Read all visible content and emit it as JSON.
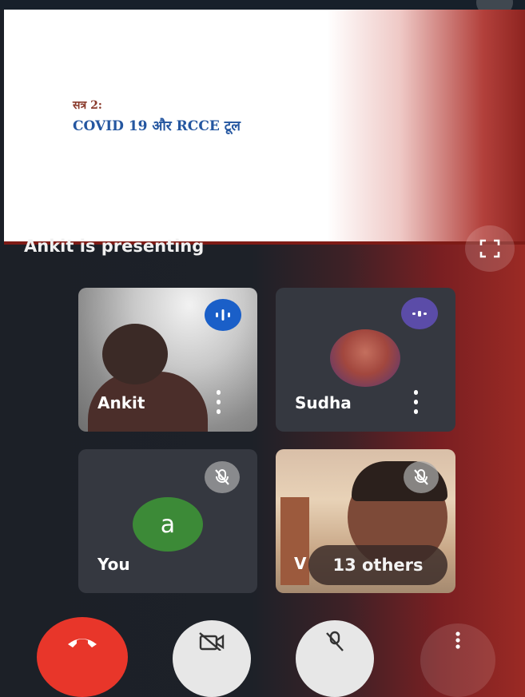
{
  "presentation": {
    "slide_line1": "सत्र 2:",
    "slide_line2": "COVID 19 और RCCE टूल",
    "presenter_status": "Ankit is presenting"
  },
  "participants": [
    {
      "name": "Ankit",
      "state": "speaking"
    },
    {
      "name": "Sudha",
      "state": "speaking"
    },
    {
      "name": "You",
      "avatar_letter": "a",
      "state": "muted"
    },
    {
      "name": "V",
      "state": "muted"
    }
  ],
  "others_count_label": "13 others",
  "colors": {
    "speaking_badge": "#1a5fc8",
    "speaking_badge_alt": "#5b4ca8",
    "end_call": "#e8362a",
    "avatar_green": "#3c8a37"
  },
  "icons": {
    "fullscreen": "fullscreen-icon",
    "end_call": "phone-hangup-icon",
    "camera": "camera-off-icon",
    "mic": "mic-off-icon",
    "more": "more-vert-icon"
  }
}
